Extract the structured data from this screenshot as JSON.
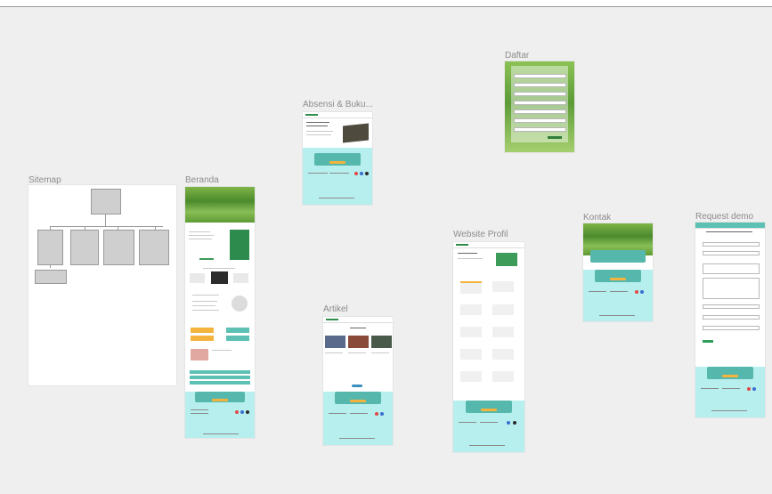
{
  "frames": {
    "sitemap": "Sitemap",
    "beranda": "Beranda",
    "absensi": "Absensi & Buku...",
    "daftar": "Daftar",
    "artikel": "Artikel",
    "website_profil": "Website Profil",
    "kontak": "Kontak",
    "request_demo": "Request demo"
  },
  "colors": {
    "canvas": "#efefef",
    "teal_footer": "#b7efee",
    "teal_card": "#56b8ac",
    "accent_orange": "#f3b33d",
    "brand_green": "#2f8c4a"
  }
}
